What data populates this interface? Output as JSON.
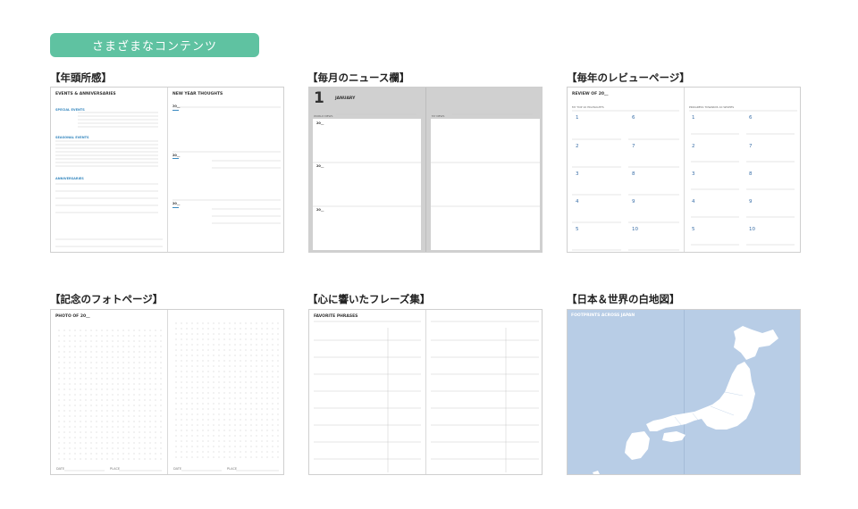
{
  "banner": {
    "label": "さまざまなコンテンツ"
  },
  "sections": [
    {
      "caption": "【年頭所感】"
    },
    {
      "caption": "【毎月のニュース欄】"
    },
    {
      "caption": "【毎年のレビューページ】"
    },
    {
      "caption": "【記念のフォトページ】"
    },
    {
      "caption": "【心に響いたフレーズ集】"
    },
    {
      "caption": "【日本＆世界の白地図】"
    }
  ],
  "t1": {
    "left_title": "EVENTS & ANNIVERSARIES",
    "special": "SPECIAL EVENTS",
    "seasonal": "SEASONAL EVENTS",
    "anniv": "ANNIVERSARIES",
    "right_title": "NEW YEAR THOUGHTS",
    "year1": "20__",
    "year2": "20__",
    "year3": "20__"
  },
  "t2": {
    "month_num": "1",
    "month": "JANUARY",
    "world": "WORLD NEWS",
    "my": "MY NEWS",
    "d1": "20__",
    "d2": "20__",
    "d3": "20__"
  },
  "t3": {
    "left_title": "REVIEW OF 20__",
    "highlights": "MY TOP 10 HIGHLIGHTS",
    "right_title": "PROGRESS TOWARDS 10 WISHES",
    "nums": [
      "1",
      "2",
      "3",
      "4",
      "5",
      "6",
      "7",
      "8",
      "9",
      "10"
    ]
  },
  "t4": {
    "title": "PHOTO OF 20__",
    "date_l": "DATE",
    "place_l": "PLACE"
  },
  "t5": {
    "title": "FAVORITE PHRASES"
  },
  "t6": {
    "title": "FOOTPRINTS ACROSS JAPAN"
  }
}
